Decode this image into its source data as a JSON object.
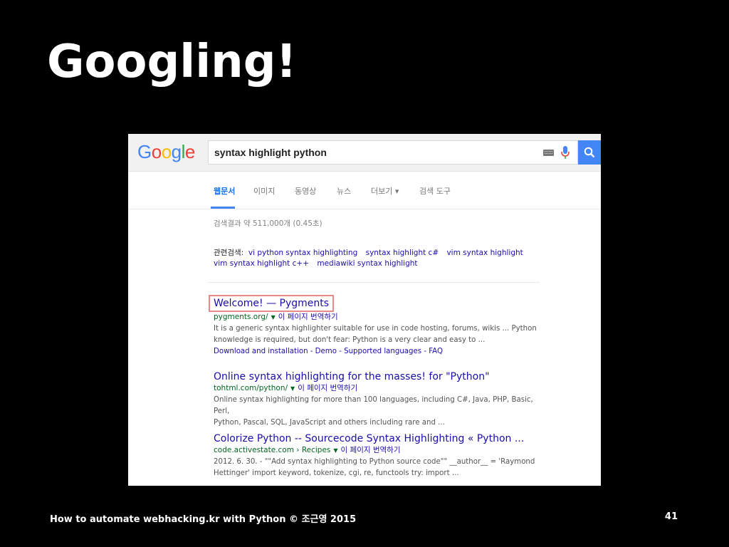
{
  "slide": {
    "title": "Googling!",
    "footer": "How to automate webhacking.kr with Python © 조근영 2015",
    "page_number": "41"
  },
  "google": {
    "logo_letters": [
      {
        "ch": "G",
        "color": "#4285f4"
      },
      {
        "ch": "o",
        "color": "#ea4335"
      },
      {
        "ch": "o",
        "color": "#fbbc05"
      },
      {
        "ch": "g",
        "color": "#4285f4"
      },
      {
        "ch": "l",
        "color": "#34a853"
      },
      {
        "ch": "e",
        "color": "#ea4335"
      }
    ],
    "search_query": "syntax highlight python",
    "tabs": [
      "웹문서",
      "이미지",
      "동영상",
      "뉴스",
      "더보기 ▾",
      "검색 도구"
    ],
    "result_stats": "검색결과 약 511,000개 (0.45초)",
    "related_label": "관련검색:",
    "related_links": [
      "vi python syntax highlighting",
      "syntax highlight c#",
      "vim syntax highlight",
      "vim syntax highlight c++",
      "mediawiki syntax highlight"
    ],
    "results": [
      {
        "title": "Welcome! — Pygments",
        "url": "pygments.org/",
        "url_extra": "",
        "translate": "이 페이지 번역하기",
        "snippet_line1": "It is a generic syntax highlighter suitable for use in code hosting, forums, wikis ... Python",
        "snippet_line2": "knowledge is required, but don't fear: Python is a very clear and easy to ...",
        "sublinks": "Download and installation - Demo - Supported languages - FAQ"
      },
      {
        "title": "Online syntax highlighting for the masses! for \"Python\"",
        "url": "tohtml.com/python/",
        "url_extra": "",
        "translate": "이 페이지 번역하기",
        "snippet_line1": "Online syntax highlighting for more than 100 languages, including C#, Java, PHP, Basic, Perl,",
        "snippet_line2": "Python, Pascal, SQL, JavaScript and others including rare and ...",
        "sublinks": ""
      },
      {
        "title": "Colorize Python -- Sourcecode Syntax Highlighting « Python ...",
        "url": "code.activestate.com",
        "url_extra": "› Recipes",
        "translate": "이 페이지 번역하기",
        "snippet_line1": "2012. 6. 30. - \"\"Add syntax highlighting to Python source code\"\" __author__ = 'Raymond",
        "snippet_line2": "Hettinger' import keyword, tokenize, cgi, re, functools try: import ...",
        "sublinks": ""
      }
    ]
  }
}
